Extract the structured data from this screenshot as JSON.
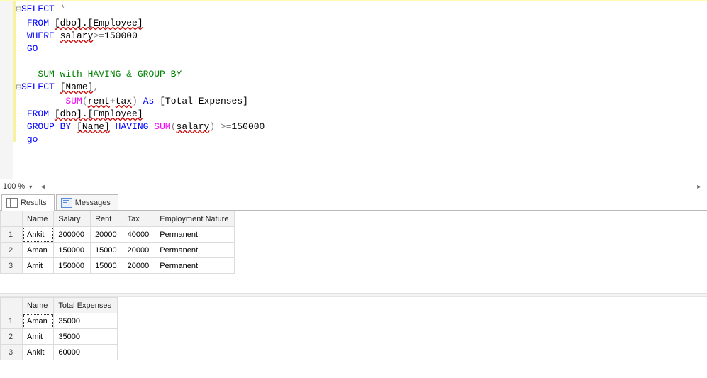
{
  "zoom": {
    "label": "100 %"
  },
  "code": {
    "l1_select": "SELECT",
    "l1_star": "*",
    "l2_from": "FROM",
    "l2_ident": "[dbo].[Employee]",
    "l3_where": "WHERE",
    "l3_col": "salary",
    "l3_op": ">=",
    "l3_val": "150000",
    "l4_go": "GO",
    "l6_comment": "--SUM with HAVING & GROUP BY",
    "l7_select": "SELECT",
    "l7_name": "[Name]",
    "l8_sum": "SUM",
    "l8_args": "rent",
    "l8_plus": "+",
    "l8_args2": "tax",
    "l8_as": "As",
    "l8_alias": "[Total Expenses]",
    "l9_from": "FROM",
    "l9_ident": "[dbo].[Employee]",
    "l10_group": "GROUP BY",
    "l10_name": "[Name]",
    "l10_having": "HAVING",
    "l10_sum": "SUM",
    "l10_arg": "salary",
    "l10_op": " >=",
    "l10_val": "150000",
    "l11_go": "go"
  },
  "tabs": {
    "results": "Results",
    "messages": "Messages"
  },
  "grid1": {
    "headers": [
      "Name",
      "Salary",
      "Rent",
      "Tax",
      "Employment Nature"
    ],
    "rows": [
      {
        "n": "1",
        "c": [
          "Ankit",
          "200000",
          "20000",
          "40000",
          "Permanent"
        ]
      },
      {
        "n": "2",
        "c": [
          "Aman",
          "150000",
          "15000",
          "20000",
          "Permanent"
        ]
      },
      {
        "n": "3",
        "c": [
          "Amit",
          "150000",
          "15000",
          "20000",
          "Permanent"
        ]
      }
    ]
  },
  "grid2": {
    "headers": [
      "Name",
      "Total Expenses"
    ],
    "rows": [
      {
        "n": "1",
        "c": [
          "Aman",
          "35000"
        ]
      },
      {
        "n": "2",
        "c": [
          "Amit",
          "35000"
        ]
      },
      {
        "n": "3",
        "c": [
          "Ankit",
          "60000"
        ]
      }
    ]
  }
}
